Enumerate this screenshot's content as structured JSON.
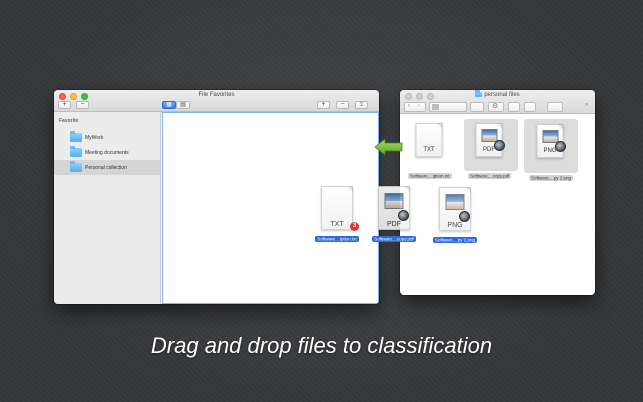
{
  "main_window": {
    "title": "File Favorites",
    "add_label": "+",
    "remove_label": "−",
    "sidebar": {
      "header": "Favorite",
      "items": [
        {
          "label": "MyWork",
          "icon": "folder-icon"
        },
        {
          "label": "Meeting documents",
          "icon": "folder-icon"
        },
        {
          "label": "Personal collection",
          "icon": "folder-icon",
          "selected": true
        }
      ]
    },
    "toolbar": {
      "add_label": "+",
      "remove_label": "−",
      "share_icon": "share-icon",
      "view_icons": [
        "grid-view-icon",
        "list-view-icon"
      ]
    }
  },
  "finder_window": {
    "title": "personal files",
    "files": [
      {
        "ext": "TXT",
        "name": "Software....iption.txt"
      },
      {
        "ext": "PDF",
        "name": "Software....copy.pdf"
      },
      {
        "ext": "PNG",
        "name": "Software....py 2.png"
      }
    ]
  },
  "dragged_files": [
    {
      "ext": "TXT",
      "name": "Software....iption.txt",
      "badge": "3"
    },
    {
      "ext": "PDF",
      "name": "Software....copy.pdf"
    },
    {
      "ext": "PNG",
      "name": "Software....py 2.png"
    }
  ],
  "caption": "Drag and drop files to classification",
  "colors": {
    "accent": "#2b6ad8",
    "arrow": "#7cc23a",
    "badge": "#e5322b",
    "folder": "#54aeea"
  }
}
